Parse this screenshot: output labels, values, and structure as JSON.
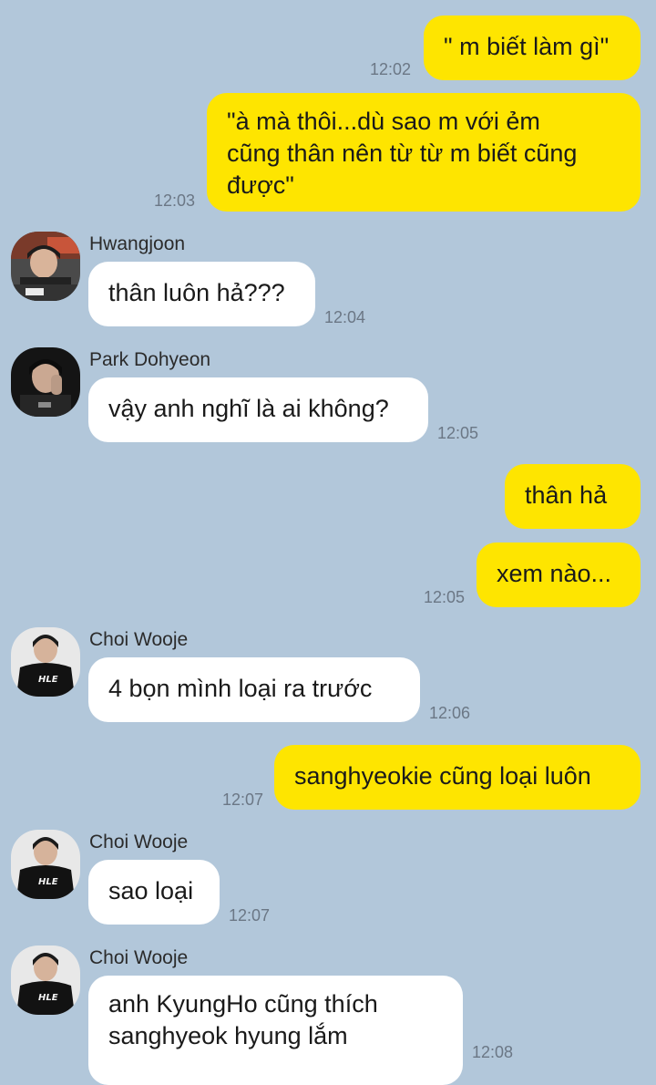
{
  "messages": [
    {
      "text": "\" m biết làm gì\"",
      "time": "12:02"
    },
    {
      "text": "\"à mà thôi...dù sao m với ẻm\ncũng thân nên từ từ m biết cũng\nđược\"",
      "time": "12:03"
    },
    {
      "sender": "Hwangjoon",
      "text": "thân luôn hả???",
      "time": "12:04"
    },
    {
      "sender": "Park Dohyeon",
      "text": "vậy anh nghĩ là ai không?",
      "time": "12:05"
    },
    {
      "text": "thân hả"
    },
    {
      "text": "xem nào...",
      "time": "12:05"
    },
    {
      "sender": "Choi Wooje",
      "text": "4 bọn mình loại ra trước",
      "time": "12:06"
    },
    {
      "text": "sanghyeokie cũng loại luôn",
      "time": "12:07"
    },
    {
      "sender": "Choi Wooje",
      "text": "sao loại",
      "time": "12:07"
    },
    {
      "sender": "Choi Wooje",
      "text": "anh KyungHo cũng thích\nsanghyeok hyung lắm",
      "time": "12:08"
    }
  ],
  "avatars": {
    "hwangjoon": {
      "icon": "profile-photo",
      "accent": "#b0452f"
    },
    "park": {
      "icon": "profile-photo",
      "accent": "#2a2a2a"
    },
    "choi": {
      "icon": "profile-photo",
      "logo": "HLE",
      "accent": "#f0f0f0"
    }
  },
  "colors": {
    "background": "#b2c7da",
    "my_bubble": "#fee500",
    "their_bubble": "#ffffff"
  }
}
